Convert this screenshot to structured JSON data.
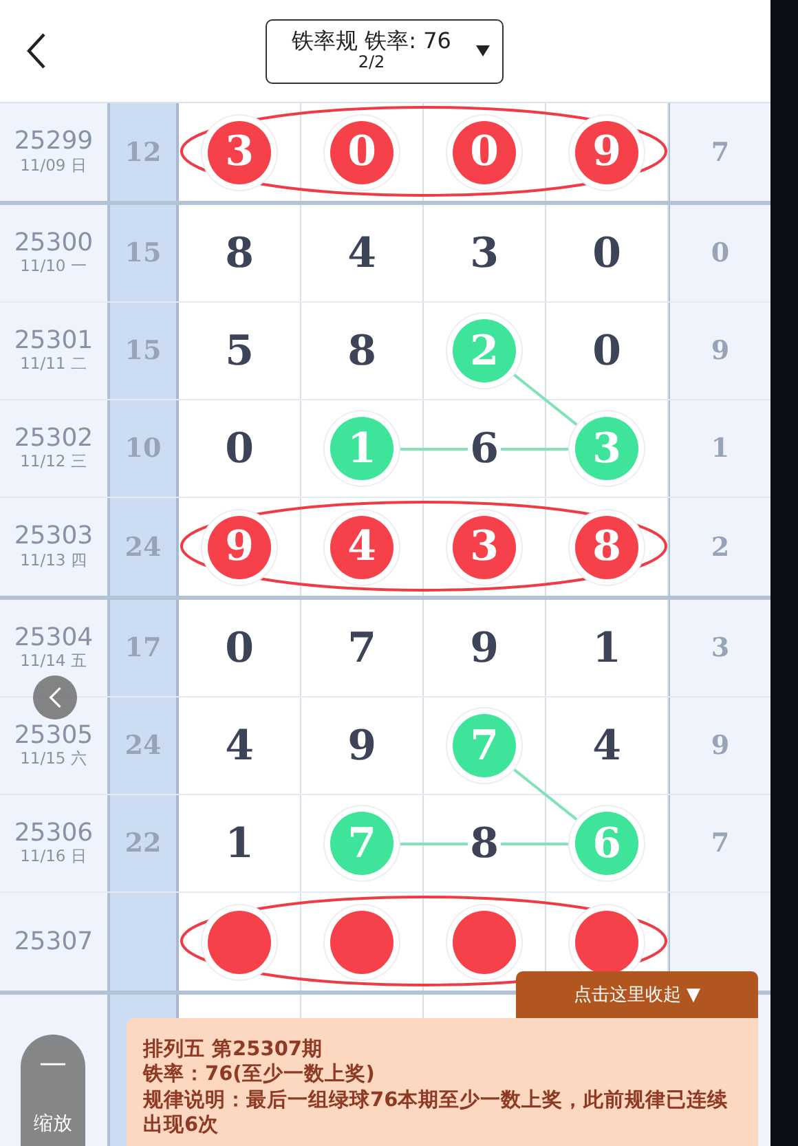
{
  "header": {
    "title": "铁率规 铁率: 76",
    "page": "2/2"
  },
  "sections": [
    {
      "rows": [
        {
          "period": "25299",
          "date": "11/09 日",
          "sum": "12",
          "circled": true,
          "digits": [
            {
              "value": "3",
              "kind": "red"
            },
            {
              "value": "0",
              "kind": "red"
            },
            {
              "value": "0",
              "kind": "red"
            },
            {
              "value": "9",
              "kind": "red"
            }
          ],
          "span": "7"
        }
      ]
    },
    {
      "rows": [
        {
          "period": "25300",
          "date": "11/10 一",
          "sum": "15",
          "circled": false,
          "digits": [
            {
              "value": "8",
              "kind": "plain"
            },
            {
              "value": "4",
              "kind": "plain"
            },
            {
              "value": "3",
              "kind": "plain"
            },
            {
              "value": "0",
              "kind": "plain"
            }
          ],
          "span": "0"
        },
        {
          "period": "25301",
          "date": "11/11 二",
          "sum": "15",
          "circled": false,
          "digits": [
            {
              "value": "5",
              "kind": "plain"
            },
            {
              "value": "8",
              "kind": "plain"
            },
            {
              "value": "2",
              "kind": "green"
            },
            {
              "value": "0",
              "kind": "plain"
            }
          ],
          "span": "9"
        },
        {
          "period": "25302",
          "date": "11/12 三",
          "sum": "10",
          "circled": false,
          "digits": [
            {
              "value": "0",
              "kind": "plain"
            },
            {
              "value": "1",
              "kind": "green"
            },
            {
              "value": "6",
              "kind": "plain"
            },
            {
              "value": "3",
              "kind": "green"
            }
          ],
          "span": "1"
        },
        {
          "period": "25303",
          "date": "11/13 四",
          "sum": "24",
          "circled": true,
          "digits": [
            {
              "value": "9",
              "kind": "red"
            },
            {
              "value": "4",
              "kind": "red"
            },
            {
              "value": "3",
              "kind": "red"
            },
            {
              "value": "8",
              "kind": "red"
            }
          ],
          "span": "2"
        }
      ]
    },
    {
      "rows": [
        {
          "period": "25304",
          "date": "11/14 五",
          "sum": "17",
          "circled": false,
          "digits": [
            {
              "value": "0",
              "kind": "plain"
            },
            {
              "value": "7",
              "kind": "plain"
            },
            {
              "value": "9",
              "kind": "plain"
            },
            {
              "value": "1",
              "kind": "plain"
            }
          ],
          "span": "3"
        },
        {
          "period": "25305",
          "date": "11/15 六",
          "sum": "24",
          "circled": false,
          "digits": [
            {
              "value": "4",
              "kind": "plain"
            },
            {
              "value": "9",
              "kind": "plain"
            },
            {
              "value": "7",
              "kind": "green"
            },
            {
              "value": "4",
              "kind": "plain"
            }
          ],
          "span": "9"
        },
        {
          "period": "25306",
          "date": "11/16 日",
          "sum": "22",
          "circled": false,
          "digits": [
            {
              "value": "1",
              "kind": "plain"
            },
            {
              "value": "7",
              "kind": "green"
            },
            {
              "value": "8",
              "kind": "plain"
            },
            {
              "value": "6",
              "kind": "green"
            }
          ],
          "span": "7"
        },
        {
          "period": "25307",
          "circled": true,
          "digits": [
            {
              "kind": "red"
            },
            {
              "kind": "red"
            },
            {
              "kind": "red"
            },
            {
              "kind": "red"
            }
          ]
        }
      ]
    }
  ],
  "zoom_button": {
    "symbol": "—",
    "label": "缩放"
  },
  "popup": {
    "toggle": "点击这里收起 ▼",
    "lines": [
      "排列五 第25307期",
      "铁率：76(至少一数上奖)",
      "规律说明：最后一组绿球76本期至少一数上奖，此前规律已连续出现6次"
    ]
  }
}
